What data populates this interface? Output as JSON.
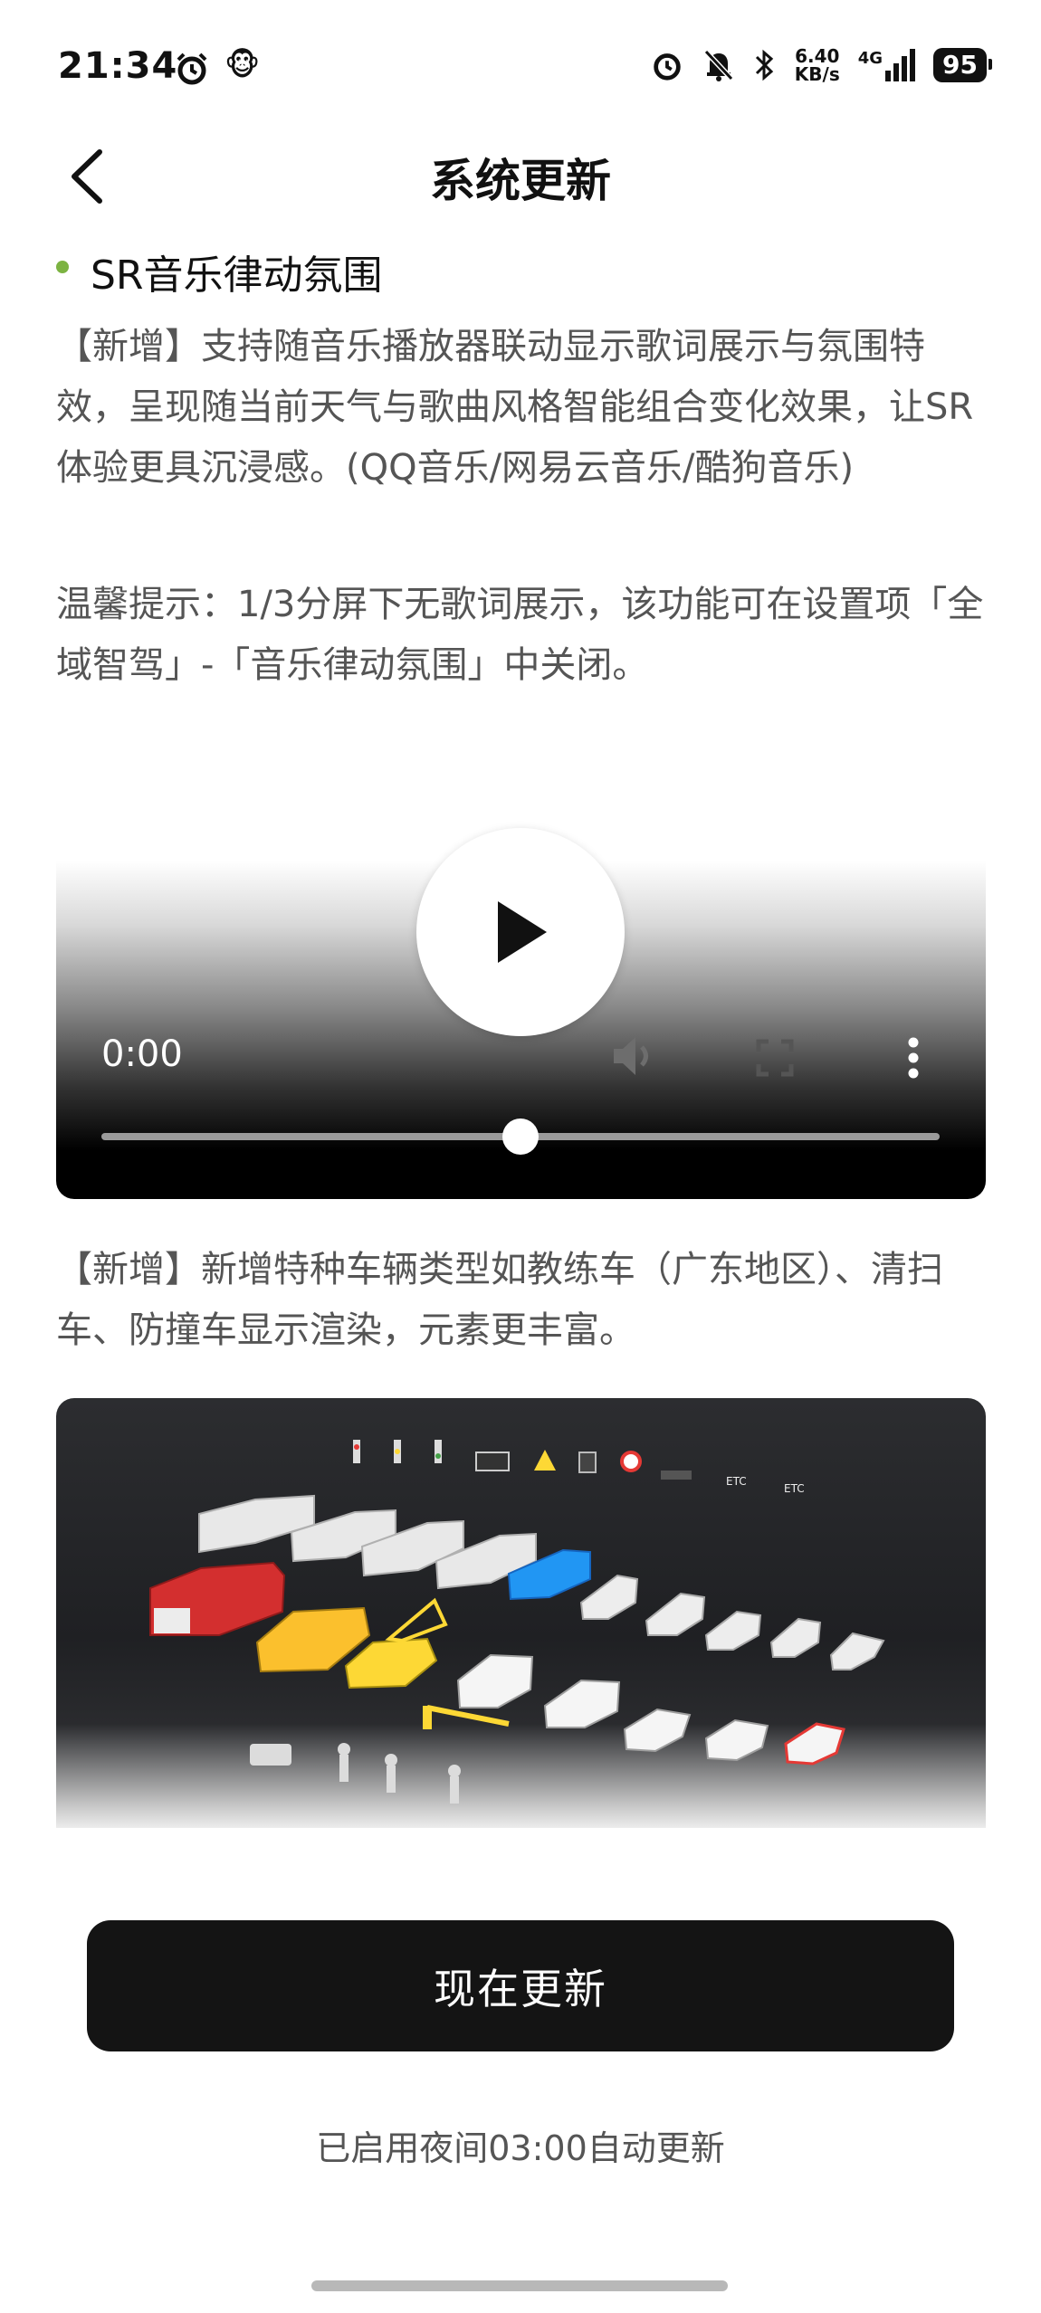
{
  "status_bar": {
    "time": "21:34",
    "speed_value": "6.40",
    "speed_unit": "KB/s",
    "network": "4G",
    "battery": "95",
    "icons": [
      "alarm-icon",
      "app-monkey-icon",
      "alarm-icon",
      "bell-off-icon",
      "bluetooth-icon",
      "signal-icon",
      "battery-icon"
    ]
  },
  "header": {
    "title": "系统更新",
    "back_icon": "chevron-left-icon"
  },
  "content": {
    "section_title": "SR音乐律动氛围",
    "paragraph_1": "【新增】支持随音乐播放器联动显示歌词展示与氛围特效，呈现随当前天气与歌曲风格智能组合变化效果，让SR体验更具沉浸感。(QQ音乐/网易云音乐/酷狗音乐)",
    "paragraph_2": "温馨提示：1/3分屏下无歌词展示，该功能可在设置项「全域智驾」-「音乐律动氛围」中关闭。",
    "paragraph_3": "【新增】新增特种车辆类型如教练车（广东地区）、清扫车、防撞车显示渲染，元素更丰富。"
  },
  "video": {
    "time": "0:00",
    "progress": 0.5,
    "icons": [
      "play-icon",
      "volume-icon",
      "fullscreen-icon",
      "more-vertical-icon"
    ]
  },
  "footer": {
    "button_label": "现在更新",
    "note": "已启用夜间03:00自动更新"
  },
  "colors": {
    "bullet": "#7cb342",
    "button_bg": "#141414",
    "text_secondary": "#555555"
  }
}
